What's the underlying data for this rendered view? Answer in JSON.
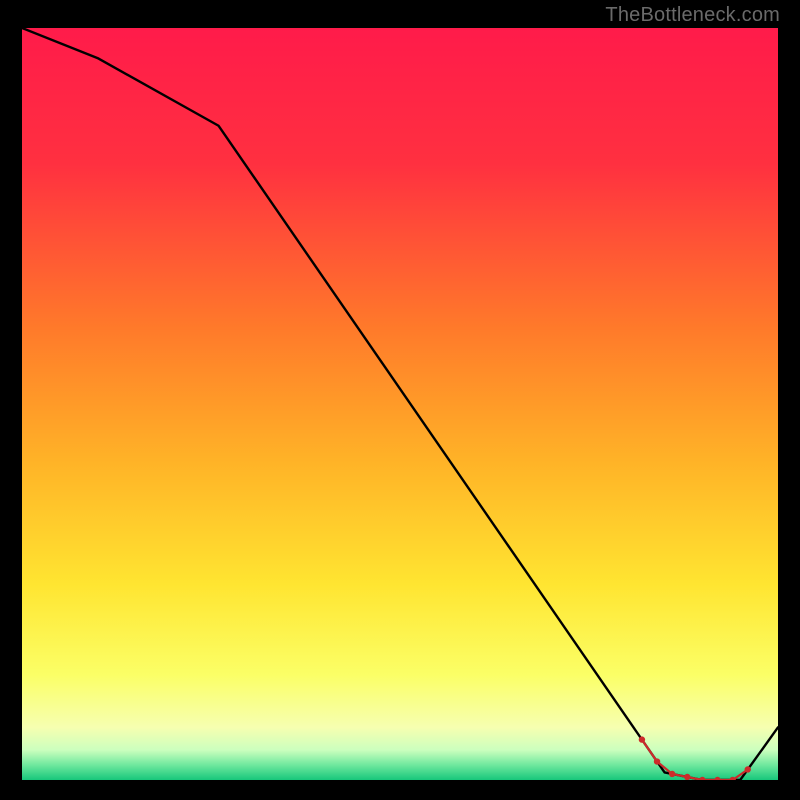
{
  "watermark": "TheBottleneck.com",
  "chart_data": {
    "type": "line",
    "title": "",
    "xlabel": "",
    "ylabel": "",
    "xlim": [
      0,
      100
    ],
    "ylim": [
      0,
      100
    ],
    "x": [
      0,
      10,
      26,
      85,
      90,
      95,
      100
    ],
    "values": [
      100,
      96,
      87,
      1,
      0,
      0,
      7
    ],
    "gradient_stops": [
      {
        "offset": 0,
        "color": "#ff1b4a"
      },
      {
        "offset": 18,
        "color": "#ff3040"
      },
      {
        "offset": 40,
        "color": "#ff7a2a"
      },
      {
        "offset": 58,
        "color": "#ffb427"
      },
      {
        "offset": 74,
        "color": "#ffe531"
      },
      {
        "offset": 86,
        "color": "#fbff66"
      },
      {
        "offset": 93,
        "color": "#f6ffb0"
      },
      {
        "offset": 96,
        "color": "#ccffbe"
      },
      {
        "offset": 98,
        "color": "#6fe89e"
      },
      {
        "offset": 100,
        "color": "#17c77b"
      }
    ],
    "markers": {
      "x": [
        82,
        84,
        86,
        88,
        90,
        92,
        94,
        96
      ],
      "color": "#cc2b2b",
      "radius": 3.2,
      "connect": true
    },
    "line_color": "#000000",
    "line_width": 2.4
  }
}
